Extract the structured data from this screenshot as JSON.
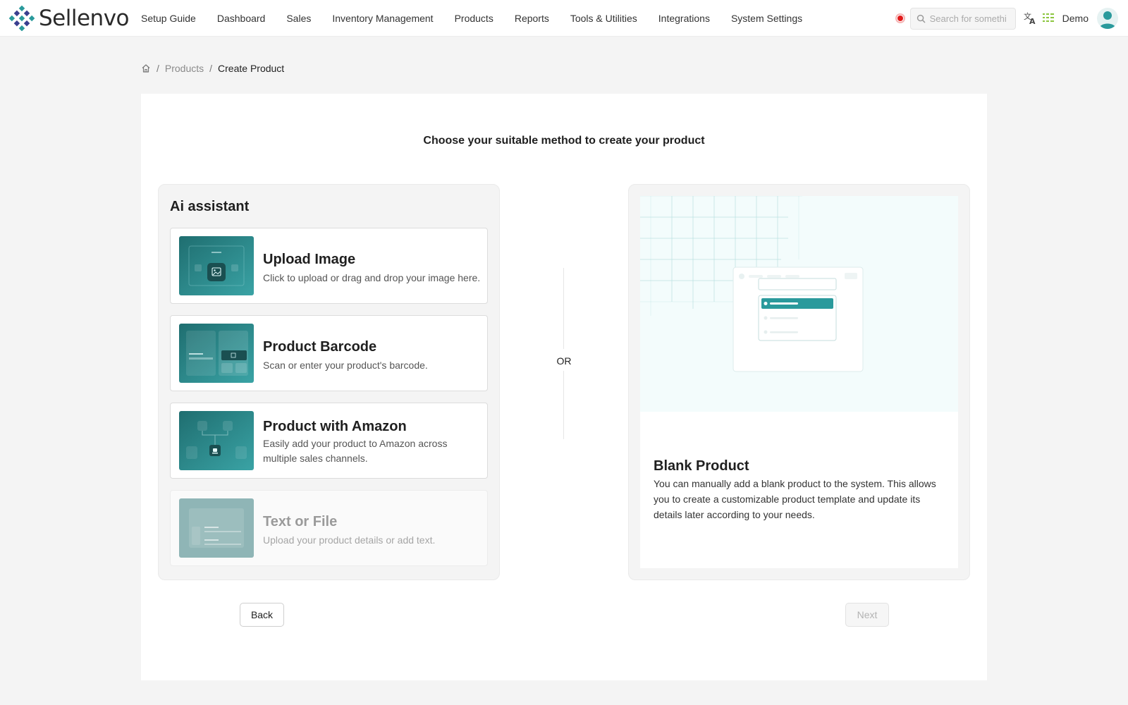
{
  "app": {
    "brand": "Sellenvo",
    "colors": {
      "accent": "#2a9a9c",
      "accent_dark": "#1f6e70",
      "recording": "#e21b1b"
    }
  },
  "nav": {
    "items": [
      {
        "label": "Setup Guide"
      },
      {
        "label": "Dashboard"
      },
      {
        "label": "Sales"
      },
      {
        "label": "Inventory Management"
      },
      {
        "label": "Products"
      },
      {
        "label": "Reports"
      },
      {
        "label": "Tools & Utilities"
      },
      {
        "label": "Integrations"
      },
      {
        "label": "System Settings"
      }
    ],
    "search_placeholder": "Search for something",
    "user": "Demo",
    "icons": [
      "record-icon",
      "search-icon",
      "translate-icon",
      "list-settings-icon",
      "user-avatar-icon"
    ]
  },
  "breadcrumb": {
    "home_icon": "home-icon",
    "items": [
      "Products",
      "Create Product"
    ]
  },
  "main": {
    "title": "Choose your suitable method to create your product",
    "ai_assistant": {
      "title": "Ai assistant",
      "options": [
        {
          "title": "Upload Image",
          "description": "Click to upload or drag and drop your image here.",
          "enabled": true
        },
        {
          "title": "Product Barcode",
          "description": "Scan or enter your product's barcode.",
          "enabled": true
        },
        {
          "title": "Product with Amazon",
          "description": "Easily add your product to Amazon across multiple sales channels.",
          "enabled": true
        },
        {
          "title": "Text or File",
          "description": "Upload your product details or add text.",
          "enabled": false
        }
      ]
    },
    "or_label": "OR",
    "blank_product": {
      "title": "Blank Product",
      "description": "You can manually add a blank product to the system. This allows you to create a customizable product template and update its details later according to your needs."
    },
    "buttons": {
      "back": "Back",
      "next": "Next",
      "next_enabled": false
    }
  }
}
